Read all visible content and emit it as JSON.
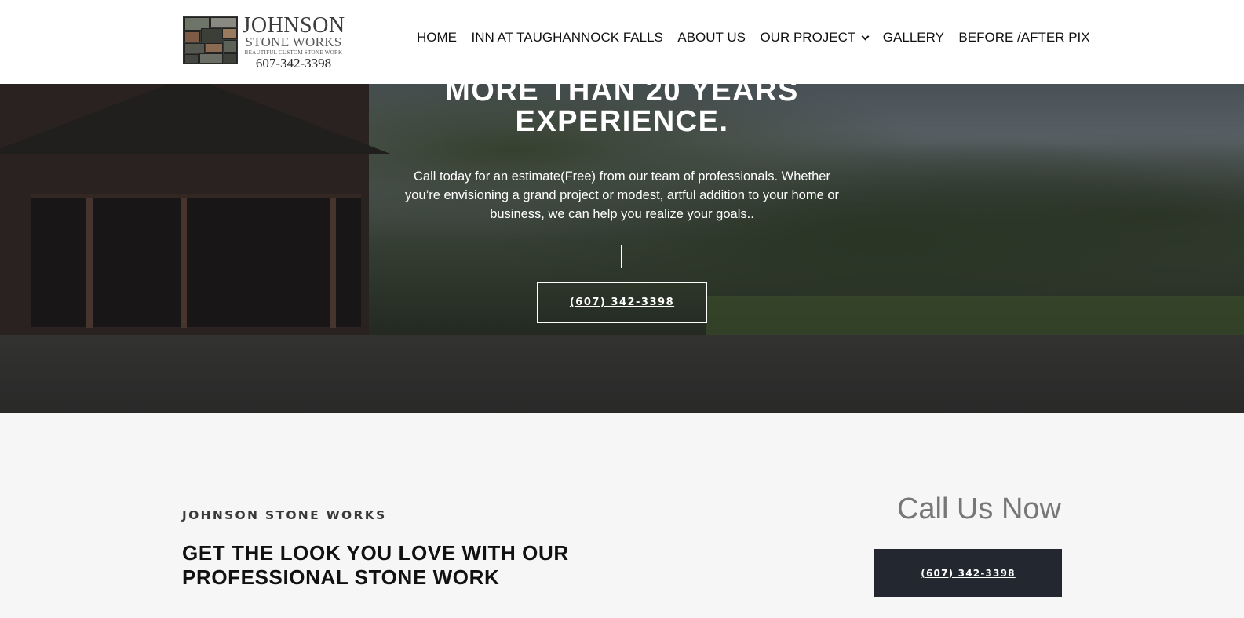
{
  "header": {
    "logo": {
      "name": "JOHNSON",
      "sub": "STONE WORKS",
      "tagline": "BEAUTIFUL CUSTOM STONE WORK",
      "phone": "607-342-3398"
    },
    "nav": [
      {
        "label": "HOME"
      },
      {
        "label": "INN AT TAUGHANNOCK FALLS"
      },
      {
        "label": "ABOUT US"
      },
      {
        "label": "OUR PROJECT",
        "has_dropdown": true
      },
      {
        "label": "GALLERY"
      },
      {
        "label": "BEFORE /AFTER PIX"
      }
    ]
  },
  "hero": {
    "title_line1": "MORE THAN 20 YEARS",
    "title_line2": "EXPERIENCE.",
    "text": "Call today for an estimate(Free) from our team of professionals. Whether you’re envisioning a grand project or modest, artful addition to your home or business, we can help you realize your goals..",
    "button_label": "(607) 342-3398"
  },
  "section": {
    "eyebrow": "JOHNSON STONE WORKS",
    "headline": "GET THE LOOK YOU LOVE WITH OUR PROFESSIONAL STONE WORK",
    "callnow": "Call Us Now",
    "button_label": "(607) 342-3398"
  },
  "colors": {
    "header_bg": "#ffffff",
    "section_bg": "#f6f6f6",
    "dark_button": "#232830",
    "callnow_text": "#777777"
  },
  "icons": [
    "chevron-down-icon"
  ]
}
